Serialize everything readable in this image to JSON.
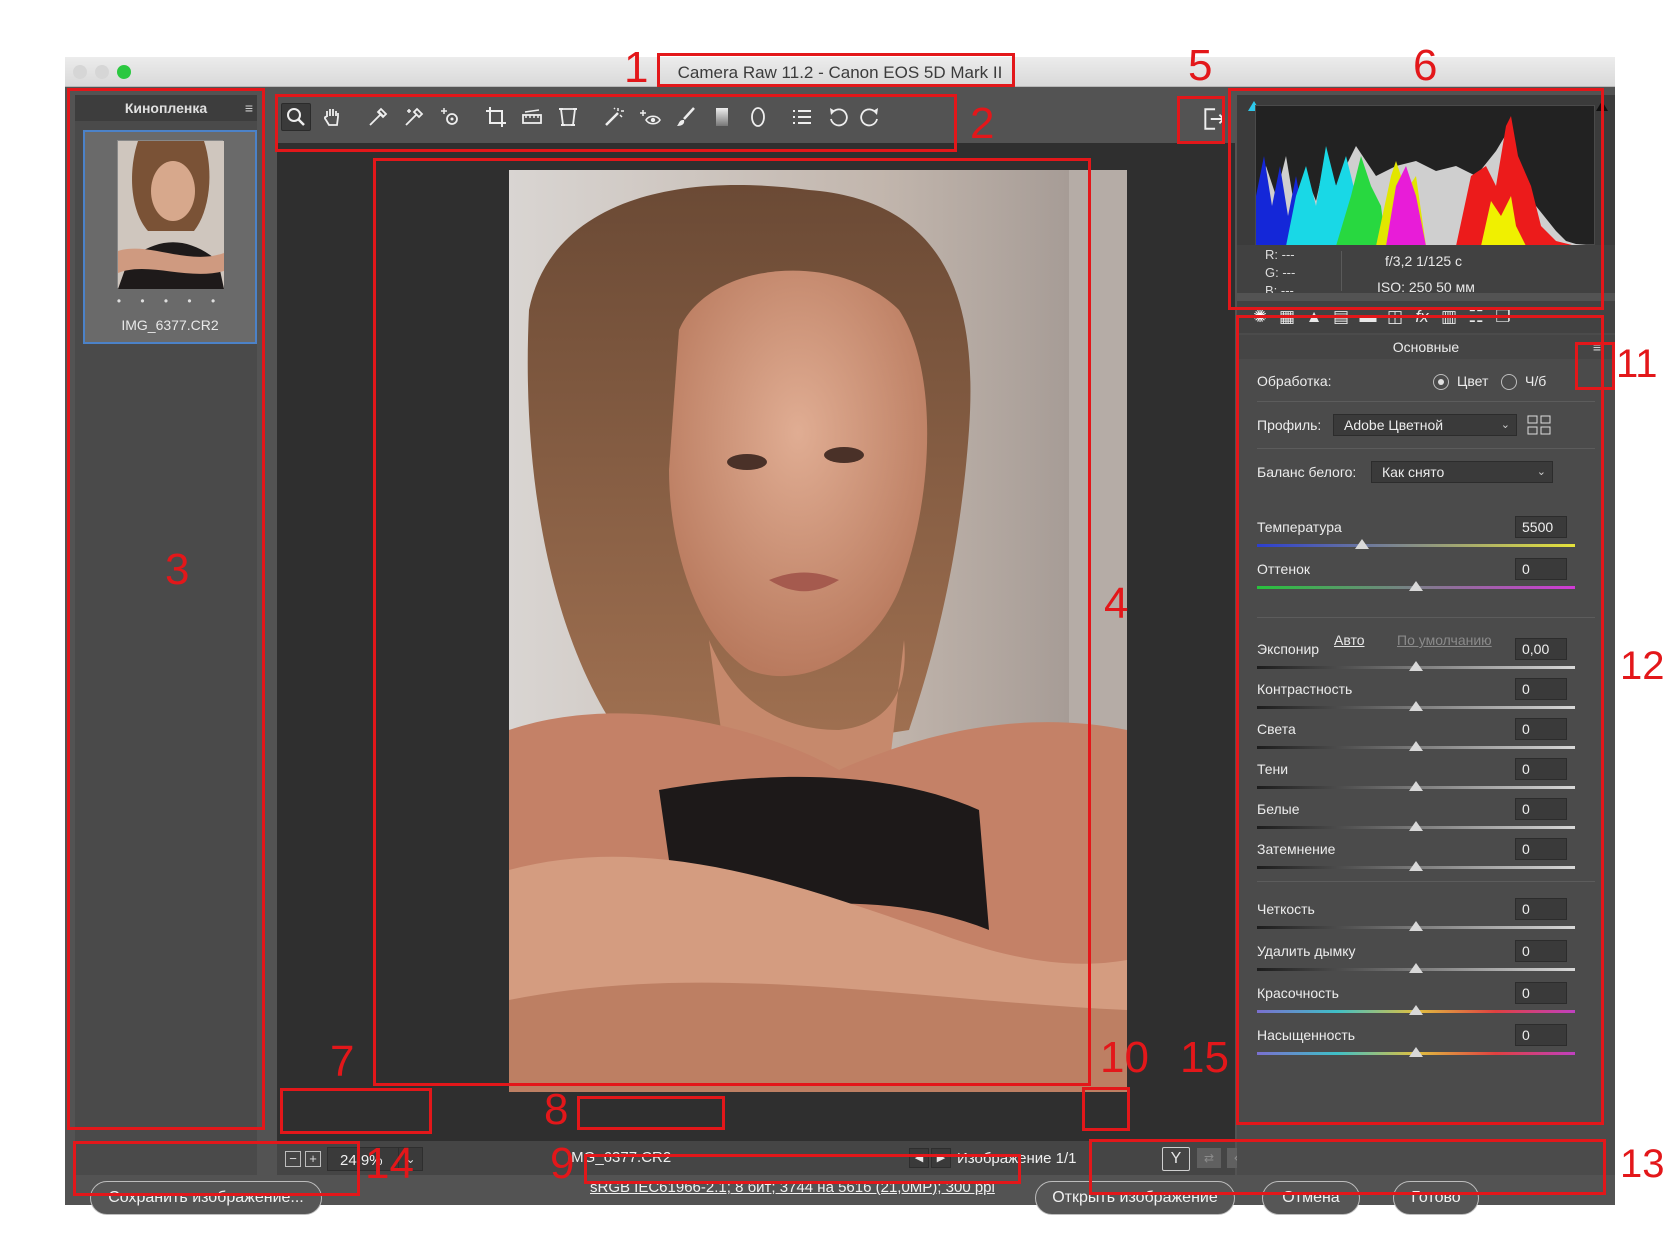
{
  "window": {
    "title": "Camera Raw 11.2  -  Canon EOS 5D Mark II",
    "traffic_lights": [
      "#d6d6d6",
      "#d6d6d6",
      "#2bc840"
    ]
  },
  "filmstrip": {
    "title": "Кинопленка",
    "thumbnail": {
      "dots": "• • • • •",
      "name": "IMG_6377.CR2"
    }
  },
  "toolbar": {
    "tools": [
      "zoom-icon",
      "hand-icon",
      "white-balance-icon",
      "color-sampler-icon",
      "targeted-adjustment-icon",
      "crop-icon",
      "straighten-icon",
      "transform-icon",
      "spot-removal-icon",
      "red-eye-icon",
      "adjustment-brush-icon",
      "graduated-filter-icon",
      "radial-filter-icon",
      "preferences-icon",
      "rotate-left-icon",
      "rotate-right-icon"
    ],
    "active_tool": "zoom-icon",
    "fullscreen_icon": "fullscreen-toggle-icon"
  },
  "preview": {
    "zoom": "24,9%",
    "file_name": "IMG_6377.CR2",
    "image_counter": "Изображение 1/1",
    "before_after_label": "Y"
  },
  "histogram": {
    "rgb": {
      "r": "R:   ---",
      "g": "G:   ---",
      "b": "B:   ---"
    },
    "exif_line1": "f/3,2     1/125 с",
    "exif_line2": "ISO: 250    50 мм"
  },
  "panel": {
    "title": "Основные",
    "tabs": [
      "basic-icon",
      "tone-curve-icon",
      "detail-icon",
      "hsl-icon",
      "split-toning-icon",
      "lens-corrections-icon",
      "effects-icon",
      "camera-calibration-icon",
      "presets-icon",
      "snapshots-icon"
    ],
    "treatment_label": "Обработка:",
    "treatment_color": "Цвет",
    "treatment_bw": "Ч/б",
    "profile_label": "Профиль:",
    "profile_value": "Adobe Цветной",
    "wb_label": "Баланс белого:",
    "wb_value": "Как снято",
    "auto_label": "Авто",
    "default_label": "По умолчанию",
    "sliders": [
      {
        "label": "Температура",
        "value": "5500",
        "position": 0.33
      },
      {
        "label": "Оттенок",
        "value": "0",
        "position": 0.5
      },
      {
        "label": "Экспонир",
        "value": "0,00",
        "position": 0.5
      },
      {
        "label": "Контрастность",
        "value": "0",
        "position": 0.5
      },
      {
        "label": "Света",
        "value": "0",
        "position": 0.5
      },
      {
        "label": "Тени",
        "value": "0",
        "position": 0.5
      },
      {
        "label": "Белые",
        "value": "0",
        "position": 0.5
      },
      {
        "label": "Затемнение",
        "value": "0",
        "position": 0.5
      },
      {
        "label": "Четкость",
        "value": "0",
        "position": 0.5
      },
      {
        "label": "Удалить дымку",
        "value": "0",
        "position": 0.5
      },
      {
        "label": "Красочность",
        "value": "0",
        "position": 0.5
      },
      {
        "label": "Насыщенность",
        "value": "0",
        "position": 0.5
      }
    ]
  },
  "footer": {
    "save_label": "Сохранить изображение...",
    "metadata": "sRGB IEC61966-2.1; 8 бит; 3744 на 5616 (21,0МР); 300 ppi",
    "open_label": "Открыть изображение",
    "cancel_label": "Отмена",
    "done_label": "Готово"
  },
  "annotations": [
    "1",
    "2",
    "3",
    "4",
    "5",
    "6",
    "7",
    "8",
    "9",
    "10",
    "11",
    "12",
    "13",
    "14",
    "15"
  ],
  "colors": {
    "annotation": "#e3171a",
    "panel_bg": "#4b4b4b",
    "selection": "#4c82c8"
  }
}
